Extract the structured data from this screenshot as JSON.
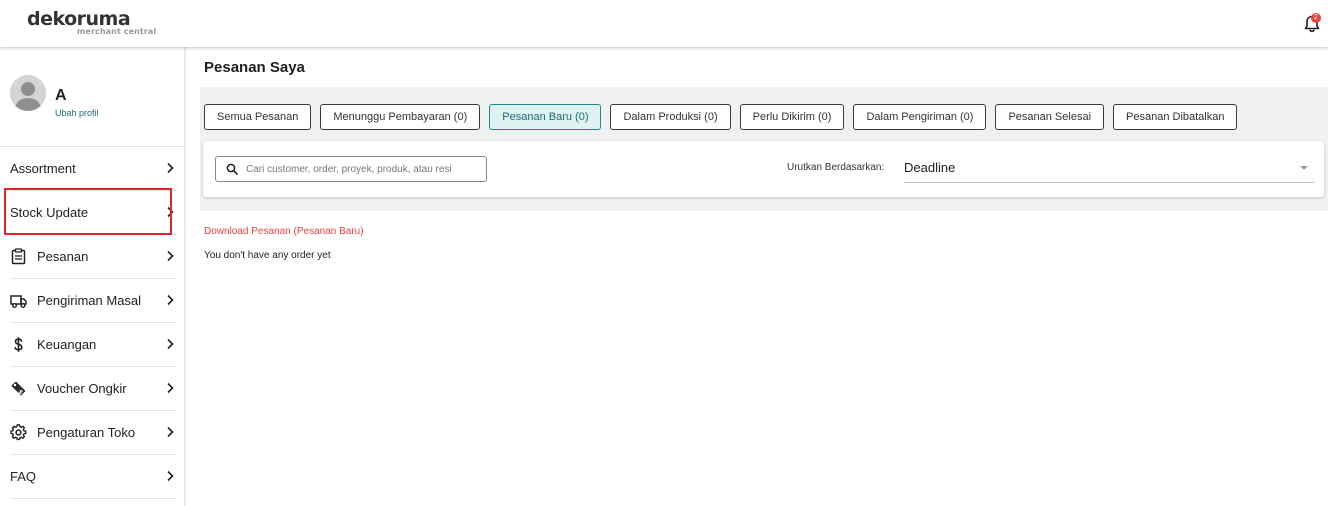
{
  "header": {
    "logo_main": "dekoruma",
    "logo_sub": "merchant central",
    "notification_count": "2"
  },
  "profile": {
    "name": "A",
    "edit_link": "Ubah profil"
  },
  "sidebar": {
    "items": [
      {
        "label": "Assortment",
        "icon": "none"
      },
      {
        "label": "Stock Update",
        "icon": "none"
      },
      {
        "label": "Pesanan",
        "icon": "clipboard-icon"
      },
      {
        "label": "Pengiriman Masal",
        "icon": "truck-icon"
      },
      {
        "label": "Keuangan",
        "icon": "dollar-icon"
      },
      {
        "label": "Voucher Ongkir",
        "icon": "voucher-tag-icon"
      },
      {
        "label": "Pengaturan Toko",
        "icon": "gear-icon"
      },
      {
        "label": "FAQ",
        "icon": "none"
      }
    ],
    "highlighted_item": "Stock Update"
  },
  "main": {
    "title": "Pesanan Saya",
    "tabs": [
      {
        "label": "Semua Pesanan",
        "active": false
      },
      {
        "label": "Menunggu Pembayaran (0)",
        "active": false
      },
      {
        "label": "Pesanan Baru (0)",
        "active": true
      },
      {
        "label": "Dalam Produksi (0)",
        "active": false
      },
      {
        "label": "Perlu Dikirim (0)",
        "active": false
      },
      {
        "label": "Dalam Pengiriman (0)",
        "active": false
      },
      {
        "label": "Pesanan Selesai",
        "active": false
      },
      {
        "label": "Pesanan Dibatalkan",
        "active": false
      }
    ],
    "search": {
      "placeholder": "Cari customer, order, proyek, produk, atau resi",
      "value": ""
    },
    "sort": {
      "label": "Urutkan Berdasarkan:",
      "selected": "Deadline"
    },
    "download_link": "Download Pesanan (Pesanan Baru)",
    "empty_message": "You don't have any order yet"
  },
  "colors": {
    "accent": "#1d8a8f",
    "link_red": "#e8453c",
    "highlight_border": "#e0262d",
    "panel_bg": "#f0f1f1"
  }
}
